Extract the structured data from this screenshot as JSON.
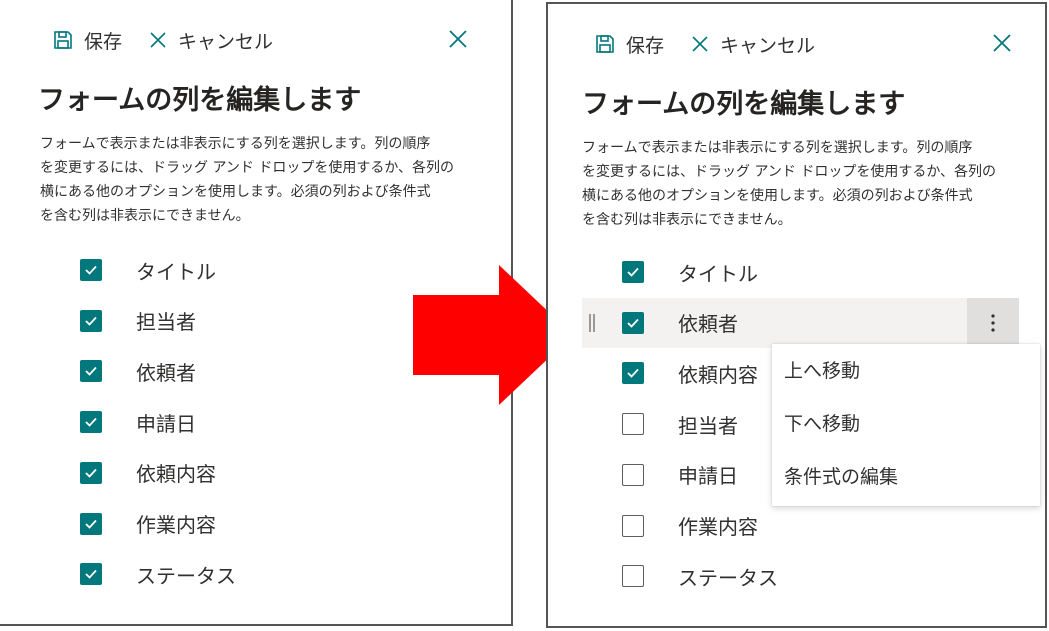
{
  "toolbar": {
    "save_label": "保存",
    "cancel_label": "キャンセル"
  },
  "title": "フォームの列を編集します",
  "description": {
    "lines": [
      "フォームで表示または非表示にする列を選択します。列の順序",
      "を変更するには、ドラッグ アンド ドロップを使用するか、各列の",
      "横にある他のオプションを使用します。必須の列および条件式",
      "を含む列は非表示にできません。"
    ]
  },
  "before": {
    "columns": [
      {
        "label": "タイトル",
        "checked": true
      },
      {
        "label": "担当者",
        "checked": true
      },
      {
        "label": "依頼者",
        "checked": true
      },
      {
        "label": "申請日",
        "checked": true
      },
      {
        "label": "依頼内容",
        "checked": true
      },
      {
        "label": "作業内容",
        "checked": true
      },
      {
        "label": "ステータス",
        "checked": true
      }
    ]
  },
  "after": {
    "columns": [
      {
        "label": "タイトル",
        "checked": true
      },
      {
        "label": "依頼者",
        "checked": true
      },
      {
        "label": "依頼内容",
        "checked": true
      },
      {
        "label": "担当者",
        "checked": false
      },
      {
        "label": "申請日",
        "checked": false
      },
      {
        "label": "作業内容",
        "checked": false
      },
      {
        "label": "ステータス",
        "checked": false
      }
    ],
    "menu": {
      "items": [
        "上へ移動",
        "下へ移動",
        "条件式の編集"
      ]
    }
  },
  "colors": {
    "accent": "#03787c",
    "arrow": "#ff0000"
  },
  "icons": {
    "save": "save-icon",
    "cancel": "cancel-icon",
    "close": "close-icon",
    "check": "checkmark-icon",
    "more": "more-vertical-icon",
    "grip": "drag-handle-icon"
  }
}
